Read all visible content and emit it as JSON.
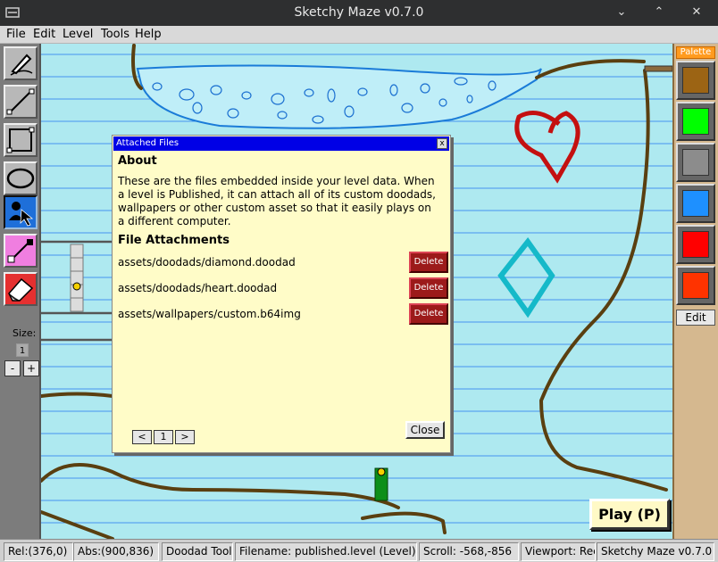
{
  "window": {
    "title": "Sketchy Maze v0.7.0",
    "minimize": "⌄",
    "maximize": "⌃",
    "close": "✕"
  },
  "menu": {
    "items": [
      "File",
      "Edit",
      "Level",
      "Tools",
      "Help"
    ]
  },
  "toolbar": {
    "size_label": "Size:",
    "size_value": "1",
    "minus": "-",
    "plus": "+"
  },
  "palette": {
    "title": "Palette",
    "swatches": [
      "#9c6414",
      "#00ff00",
      "#8c8c8c",
      "#1e90ff",
      "#ff0000",
      "#ff3300"
    ],
    "edit_label": "Edit"
  },
  "play_button": "Play (P)",
  "status": {
    "rel": "Rel:(376,0)",
    "abs": "Abs:(900,836)",
    "tool": "Doodad Tool",
    "filename": "Filename: published.level (Level)",
    "scroll": "Scroll: -568,-856",
    "viewport": "Viewport: Rec",
    "app": "Sketchy Maze v0.7.0"
  },
  "dialog": {
    "title": "Attached Files",
    "close_x": "x",
    "about_heading": "About",
    "about_lines": [
      "These are the files embedded inside your level data. When",
      "a level is Published, it can attach all of its custom doodads,",
      "wallpapers or other custom asset so that it easily plays on",
      "a different computer."
    ],
    "attachments_heading": "File Attachments",
    "files": [
      {
        "name": "assets/doodads/diamond.doodad",
        "action": "Delete"
      },
      {
        "name": "assets/doodads/heart.doodad",
        "action": "Delete"
      },
      {
        "name": "assets/wallpapers/custom.b64img",
        "action": "Delete"
      }
    ],
    "pager": {
      "prev": "<",
      "page": "1",
      "next": ">"
    },
    "close_button": "Close"
  }
}
